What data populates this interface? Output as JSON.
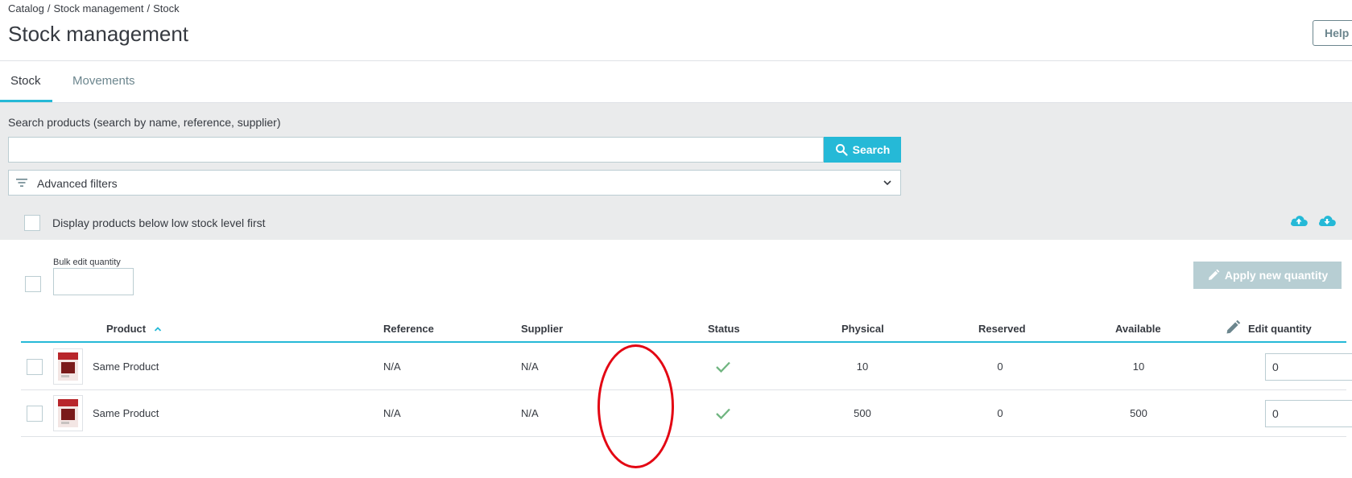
{
  "breadcrumb": [
    "Catalog",
    "Stock management",
    "Stock"
  ],
  "page_title": "Stock management",
  "help_label": "Help",
  "tabs": [
    {
      "label": "Stock",
      "active": true
    },
    {
      "label": "Movements",
      "active": false
    }
  ],
  "search": {
    "label": "Search products (search by name, reference, supplier)",
    "value": "",
    "placeholder": "",
    "button_label": "Search"
  },
  "filters": {
    "label": "Advanced filters"
  },
  "low_stock": {
    "label": "Display products below low stock level first",
    "checked": false
  },
  "bulk": {
    "label": "Bulk edit quantity",
    "value": "",
    "apply_label": "Apply new quantity"
  },
  "table": {
    "columns": {
      "product": "Product",
      "reference": "Reference",
      "supplier": "Supplier",
      "status": "Status",
      "physical": "Physical",
      "reserved": "Reserved",
      "available": "Available",
      "edit_quantity": "Edit quantity"
    },
    "sort": {
      "column": "Product",
      "direction": "asc"
    },
    "rows": [
      {
        "product": "Same Product",
        "reference": "N/A",
        "supplier": "N/A",
        "status": "check-icon",
        "physical": "10",
        "reserved": "0",
        "available": "10",
        "edit_quantity": "0"
      },
      {
        "product": "Same Product",
        "reference": "N/A",
        "supplier": "N/A",
        "status": "check-icon",
        "physical": "500",
        "reserved": "0",
        "available": "500",
        "edit_quantity": "0"
      }
    ]
  },
  "colors": {
    "accent": "#25b9d7",
    "status_ok": "#70b580",
    "annotation": "#e30613",
    "disabled_button": "#b7ced3"
  },
  "icons": {
    "search": "search-icon",
    "filters": "filter-list-icon",
    "chevron": "chevron-down-icon",
    "upload": "cloud-upload-icon",
    "download": "cloud-download-icon",
    "edit": "pencil-icon",
    "sort": "sort-asc-icon",
    "status": "check-icon"
  }
}
